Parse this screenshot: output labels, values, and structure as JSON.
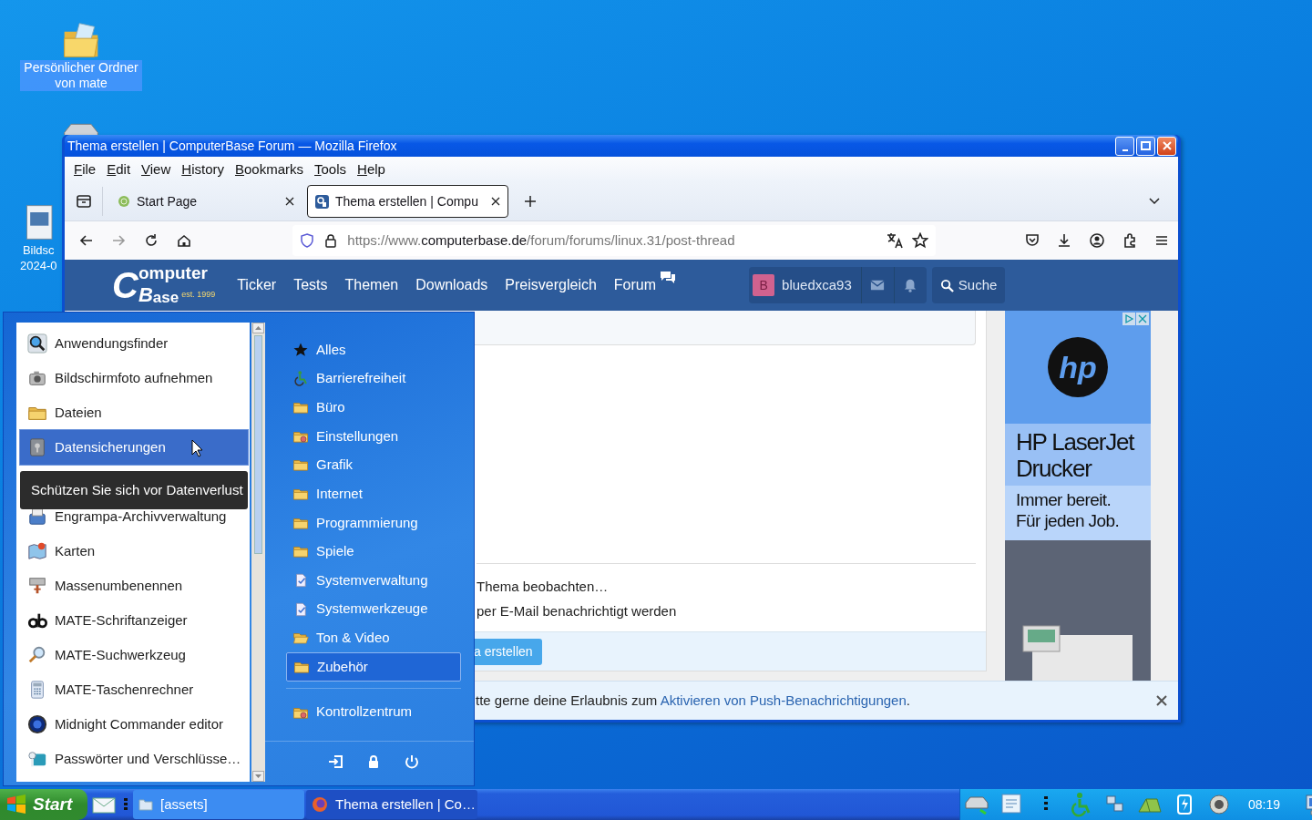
{
  "desktop_icons": [
    {
      "kind": "folder",
      "label_lines": [
        "Persönlicher Ordner",
        "von mate"
      ],
      "selected": true
    },
    {
      "kind": "drive"
    },
    {
      "kind": "image",
      "label_lines": [
        "Bildsc",
        "2024-0"
      ],
      "selected": false
    }
  ],
  "browser": {
    "title": "Thema erstellen | ComputerBase Forum — Mozilla Firefox",
    "menu": [
      "File",
      "Edit",
      "View",
      "History",
      "Bookmarks",
      "Tools",
      "Help"
    ],
    "tabs": [
      {
        "label": "Start Page",
        "kind": "globe",
        "selected": false
      },
      {
        "label": "Thema erstellen | Compu",
        "kind": "site",
        "selected": true
      }
    ],
    "url": {
      "scheme": "https://www.",
      "domain": "computerbase.de",
      "path": "/forum/forums/linux.31/post-thread"
    },
    "site": {
      "logo": {
        "c": "C",
        "top": "omputer",
        "b": "B",
        "bottom": "ase",
        "est": "est. 1999"
      },
      "nav": [
        "Ticker",
        "Tests",
        "Themen",
        "Downloads",
        "Preisvergleich",
        "Forum"
      ],
      "user": {
        "initial": "B",
        "name": "bluedxca93"
      },
      "search": "Suche"
    },
    "content": {
      "lines": [
        "Thema beobachten…",
        "per E-Mail benachrichtigt werden"
      ],
      "submit": "a erstellen"
    },
    "notice": {
      "text": "tte gerne deine Erlaubnis zum ",
      "link": "Aktivieren von Push-Benachrichtigungen",
      "end": "."
    },
    "ad": {
      "logo": "hp",
      "headline": "HP LaserJet Drucker",
      "tagline": [
        "Immer bereit.",
        "Für jeden Job."
      ]
    }
  },
  "start_menu": {
    "apps": [
      {
        "label": "Anwendungsfinder",
        "kind": "finder",
        "selected": false
      },
      {
        "label": "Bildschirmfoto aufnehmen",
        "kind": "camera",
        "selected": false
      },
      {
        "label": "Dateien",
        "kind": "folder",
        "selected": false
      },
      {
        "label": "Datensicherungen",
        "kind": "backup",
        "selected": true
      },
      {
        "kind": "hidden",
        "selected": false
      },
      {
        "label": "Engrampa-Archivverwaltung",
        "kind": "archive",
        "selected": false
      },
      {
        "label": "Karten",
        "kind": "map",
        "selected": false
      },
      {
        "label": "Massenumbenennen",
        "kind": "rename",
        "selected": false
      },
      {
        "label": "MATE-Schriftanzeiger",
        "kind": "font",
        "selected": false
      },
      {
        "label": "MATE-Suchwerkzeug",
        "kind": "search",
        "selected": false
      },
      {
        "label": "MATE-Taschenrechner",
        "kind": "calculator",
        "selected": false
      },
      {
        "label": "Midnight Commander editor",
        "kind": "disc",
        "selected": false
      },
      {
        "label": "Passwörter und Verschlüsse…",
        "kind": "keys",
        "selected": false
      }
    ],
    "tooltip": "Schützen Sie sich vor Datenverlust",
    "categories": [
      {
        "label": "Alles",
        "kind": "star",
        "selected": false
      },
      {
        "label": "Barrierefreiheit",
        "kind": "access",
        "selected": false
      },
      {
        "label": "Büro",
        "kind": "folder",
        "selected": false
      },
      {
        "label": "Einstellungen",
        "kind": "settings",
        "selected": false
      },
      {
        "label": "Grafik",
        "kind": "folder",
        "selected": false
      },
      {
        "label": "Internet",
        "kind": "folder",
        "selected": false
      },
      {
        "label": "Programmierung",
        "kind": "folder",
        "selected": false
      },
      {
        "label": "Spiele",
        "kind": "folder",
        "selected": false
      },
      {
        "label": "Systemverwaltung",
        "kind": "system",
        "selected": false
      },
      {
        "label": "Systemwerkzeuge",
        "kind": "system",
        "selected": false
      },
      {
        "label": "Ton & Video",
        "kind": "open",
        "selected": false
      },
      {
        "label": "Zubehör",
        "kind": "folder",
        "selected": true
      }
    ],
    "control_center": "Kontrollzentrum"
  },
  "taskbar": {
    "start": "Start",
    "tasks": [
      {
        "label": "[assets]",
        "kind": "folder",
        "selected": true
      },
      {
        "label": "Thema erstellen | Co…",
        "kind": "firefox",
        "selected": false
      }
    ],
    "clock": "08:19"
  }
}
